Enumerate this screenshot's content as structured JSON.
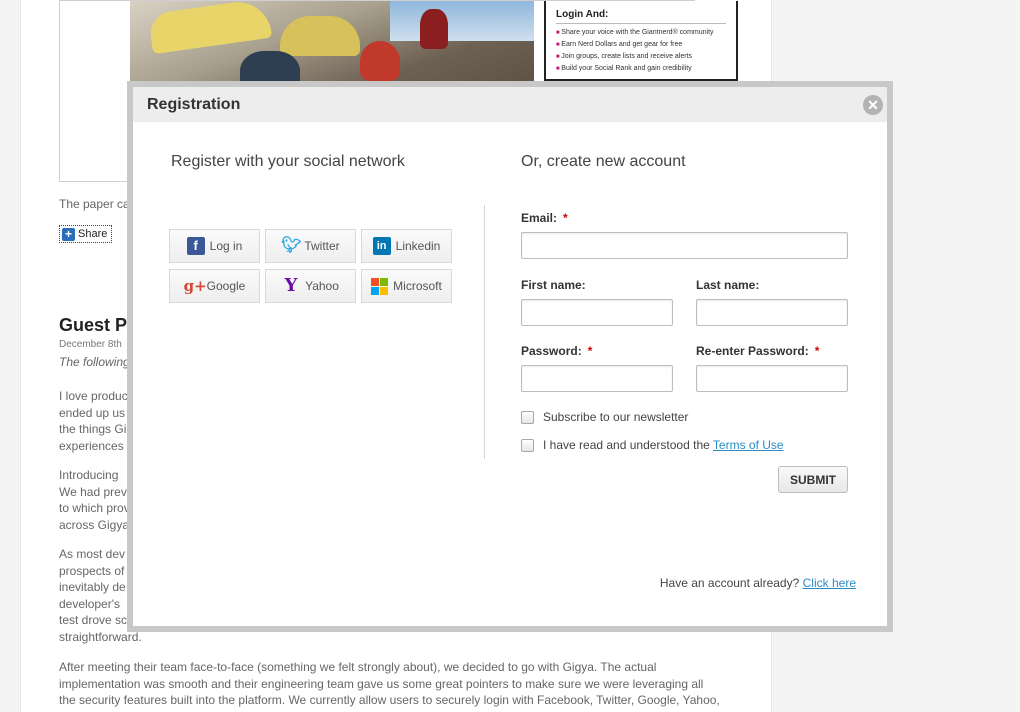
{
  "background": {
    "promo": {
      "title": "Login And:",
      "items": [
        "Share your voice with the Giantnerd® community",
        "Earn Nerd Dollars and get gear for free",
        "Join groups, create lists and receive alerts",
        "Build your Social Rank and gain credibility"
      ]
    },
    "caption": "The paper ca",
    "share_label": "Share",
    "post_title": "Guest P",
    "post_date": "December 8th",
    "post_intro": "The following",
    "paragraphs": [
      "I love produc\nended up us\nthe things Gi\nexperiences",
      "Introducing\nWe had prev\nto which prov\nacross Gigya",
      "As most dev\nprospects of\ninevitably de\ndeveloper's\ntest drove sc\nstraightforward.",
      "After meeting their team face-to-face (something we felt strongly about), we decided to go with Gigya. The actual\nimplementation was smooth and their engineering team gave us some great pointers to make sure we were leveraging all\nthe security features built into the platform. We currently allow users to securely login with Facebook, Twitter, Google, Yahoo,"
    ]
  },
  "modal": {
    "title": "Registration",
    "close_icon": "close-icon",
    "social": {
      "heading": "Register with your social network",
      "buttons": [
        {
          "label": "Log in",
          "icon": "facebook-icon"
        },
        {
          "label": "Twitter",
          "icon": "twitter-icon"
        },
        {
          "label": "Linkedin",
          "icon": "linkedin-icon"
        },
        {
          "label": "Google",
          "icon": "google-plus-icon"
        },
        {
          "label": "Yahoo",
          "icon": "yahoo-icon"
        },
        {
          "label": "Microsoft",
          "icon": "microsoft-icon"
        }
      ]
    },
    "form": {
      "heading": "Or, create new account",
      "email_label": "Email:",
      "email_value": "",
      "first_name_label": "First name:",
      "first_name_value": "",
      "last_name_label": "Last name:",
      "last_name_value": "",
      "password_label": "Password:",
      "password_value": "",
      "reenter_label": "Re-enter Password:",
      "reenter_value": "",
      "required_mark": "*",
      "newsletter_label": "Subscribe to our newsletter",
      "newsletter_checked": false,
      "terms_prefix": "I have read and understood the",
      "terms_link": "Terms of Use",
      "terms_checked": false,
      "submit_label": "SUBMIT"
    },
    "footer": {
      "have_account_text": "Have an account already?",
      "click_here": "Click here"
    }
  },
  "colors": {
    "link": "#2a8cc4",
    "required": "#cc0000",
    "facebook": "#3b5998",
    "twitter": "#2aa9e0",
    "linkedin": "#0077b5",
    "google": "#d34836",
    "yahoo": "#6b0fa8"
  }
}
